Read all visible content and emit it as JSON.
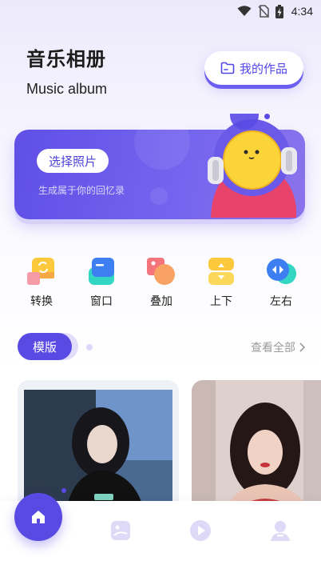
{
  "status_bar": {
    "time": "4:34",
    "icons": [
      "wifi-icon",
      "no-sim-icon",
      "battery-charging-icon"
    ]
  },
  "header": {
    "title": "音乐相册",
    "subtitle": "Music album"
  },
  "works_button": {
    "label": "我的作品",
    "icon": "folder-icon"
  },
  "banner": {
    "button_label": "选择照片",
    "subtitle": "生成属于你的回忆录",
    "mascot": "astronaut-emoji-mascot"
  },
  "tools": [
    {
      "label": "转换",
      "icon": "convert-icon"
    },
    {
      "label": "窗口",
      "icon": "window-icon"
    },
    {
      "label": "叠加",
      "icon": "overlay-icon"
    },
    {
      "label": "上下",
      "icon": "up-down-icon"
    },
    {
      "label": "左右",
      "icon": "left-right-icon"
    }
  ],
  "section": {
    "tab_label": "模版",
    "see_all": "查看全部"
  },
  "templates": [
    {
      "name": "template-photo-1"
    },
    {
      "name": "template-photo-2"
    }
  ],
  "bottom_nav": [
    {
      "name": "home",
      "icon": "home-icon",
      "active": true
    },
    {
      "name": "album",
      "icon": "picture-icon",
      "active": false
    },
    {
      "name": "video",
      "icon": "play-icon",
      "active": false
    },
    {
      "name": "profile",
      "icon": "user-icon",
      "active": false
    }
  ],
  "colors": {
    "accent": "#5a4ae4",
    "accent_light": "#e2ddfa",
    "text": "#222222",
    "muted": "#9a9a9a"
  }
}
